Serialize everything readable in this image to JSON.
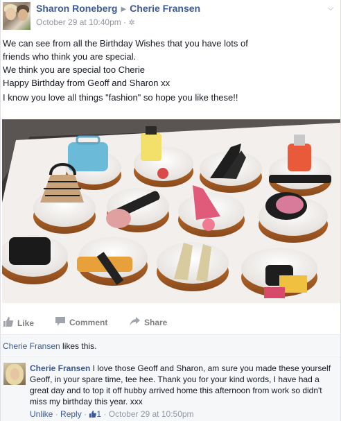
{
  "header": {
    "author": "Sharon Roneberg",
    "recipient": "Cherie Fransen",
    "timestamp": "October 29 at 10:40pm",
    "separator": "·"
  },
  "message": {
    "lines": [
      "We can see from all the Birthday Wishes that you have lots of",
      "friends who think you are special.",
      "We think you are special too Cherie",
      "Happy Birthday from Geoff and Sharon xx"
    ],
    "second_paragraph": "I know you love all things \"fashion\" so hope you like these!!"
  },
  "actions": {
    "like": "Like",
    "comment": "Comment",
    "share": "Share"
  },
  "likes": {
    "name": "Cherie Fransen",
    "text": " likes this."
  },
  "comment": {
    "author": "Cherie Fransen",
    "text": " I love those Geoff and Sharon, am sure you made these yourself Geoff, in your spare time, tee hee. Thank you for your kind words, I have had a great day and to top it off hubby arrived home this afternoon from work so didn't miss my birthday this year. xxx",
    "unlike": "Unlike",
    "reply": "Reply",
    "like_count": "1",
    "timestamp": "October 29 at 10:50pm",
    "sep": "·"
  },
  "colors": {
    "link": "#3b5998",
    "muted": "#9197a3",
    "bar_bg": "#f6f7f9"
  }
}
